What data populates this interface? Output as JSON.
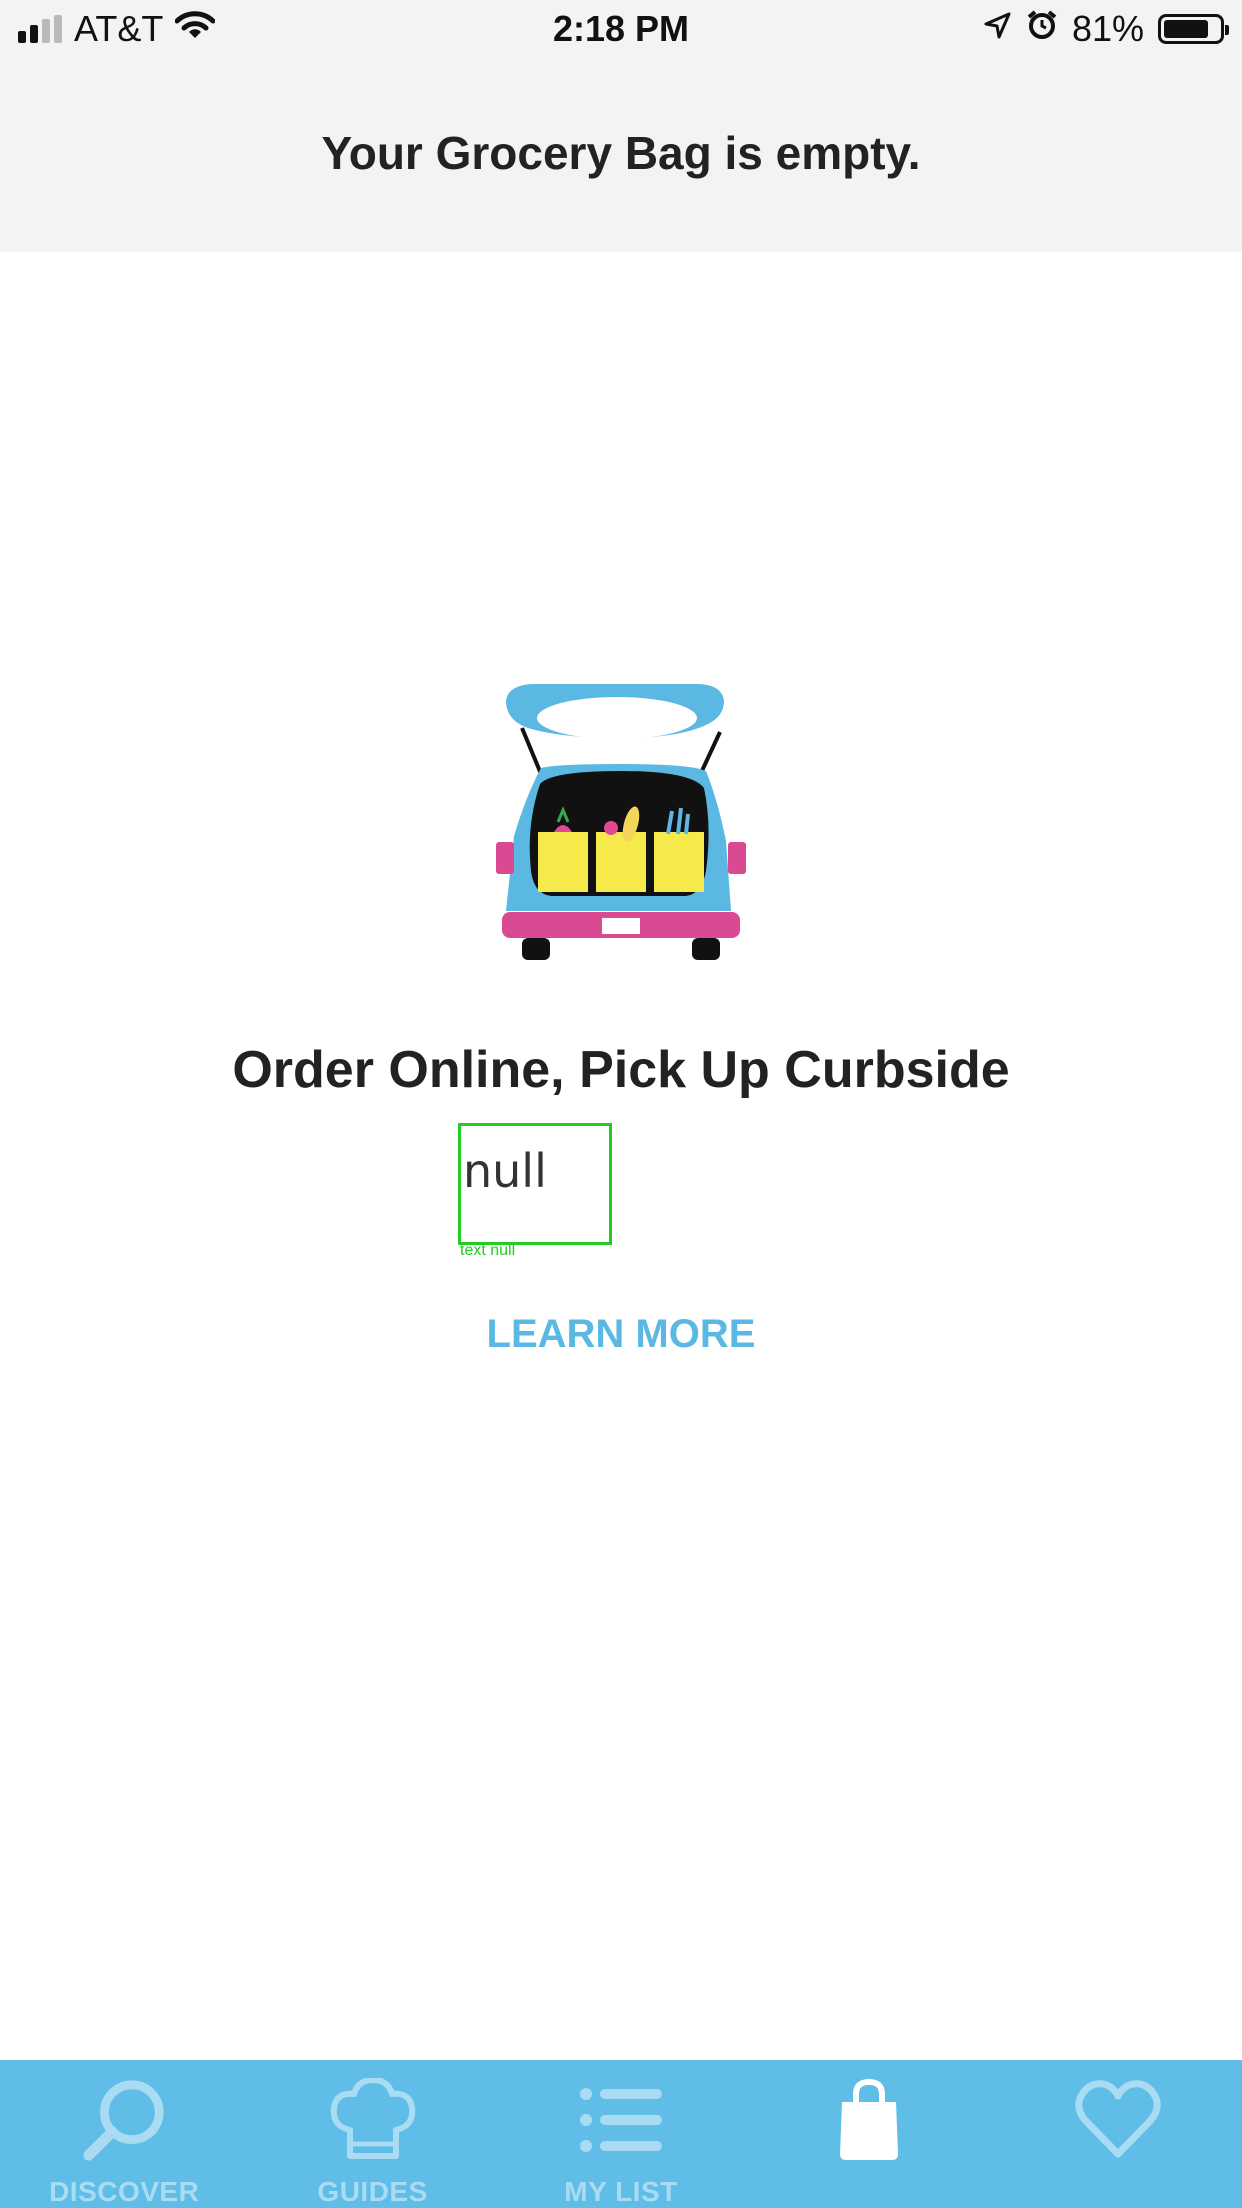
{
  "status_bar": {
    "carrier": "AT&T",
    "time": "2:18 PM",
    "battery_percent": "81%",
    "battery_level": 0.81,
    "icons": [
      "signal-icon",
      "wifi-icon",
      "location-arrow-icon",
      "alarm-icon",
      "battery-icon"
    ]
  },
  "header": {
    "title": "Your Grocery Bag is empty."
  },
  "main": {
    "illustration": "car-trunk-grocery-bags-illustration",
    "headline": "Order Online, Pick Up Curbside",
    "description": "null",
    "description_caption": "text null",
    "learn_more": "LEARN MORE"
  },
  "tab_bar": {
    "items": [
      {
        "label": "DISCOVER",
        "icon": "magnifier-icon"
      },
      {
        "label": "GUIDES",
        "icon": "chef-hat-icon"
      },
      {
        "label": "MY LIST",
        "icon": "list-icon"
      },
      {
        "label": "",
        "icon": "bag-icon",
        "active": true
      },
      {
        "label": "",
        "icon": "heart-icon"
      }
    ]
  },
  "colors": {
    "accent": "#5ab8e3",
    "tab_bar_bg": "#5fbde8",
    "tab_label": "#a9dcf3",
    "header_bg": "#f2f3f5",
    "text_dark": "#222222"
  }
}
